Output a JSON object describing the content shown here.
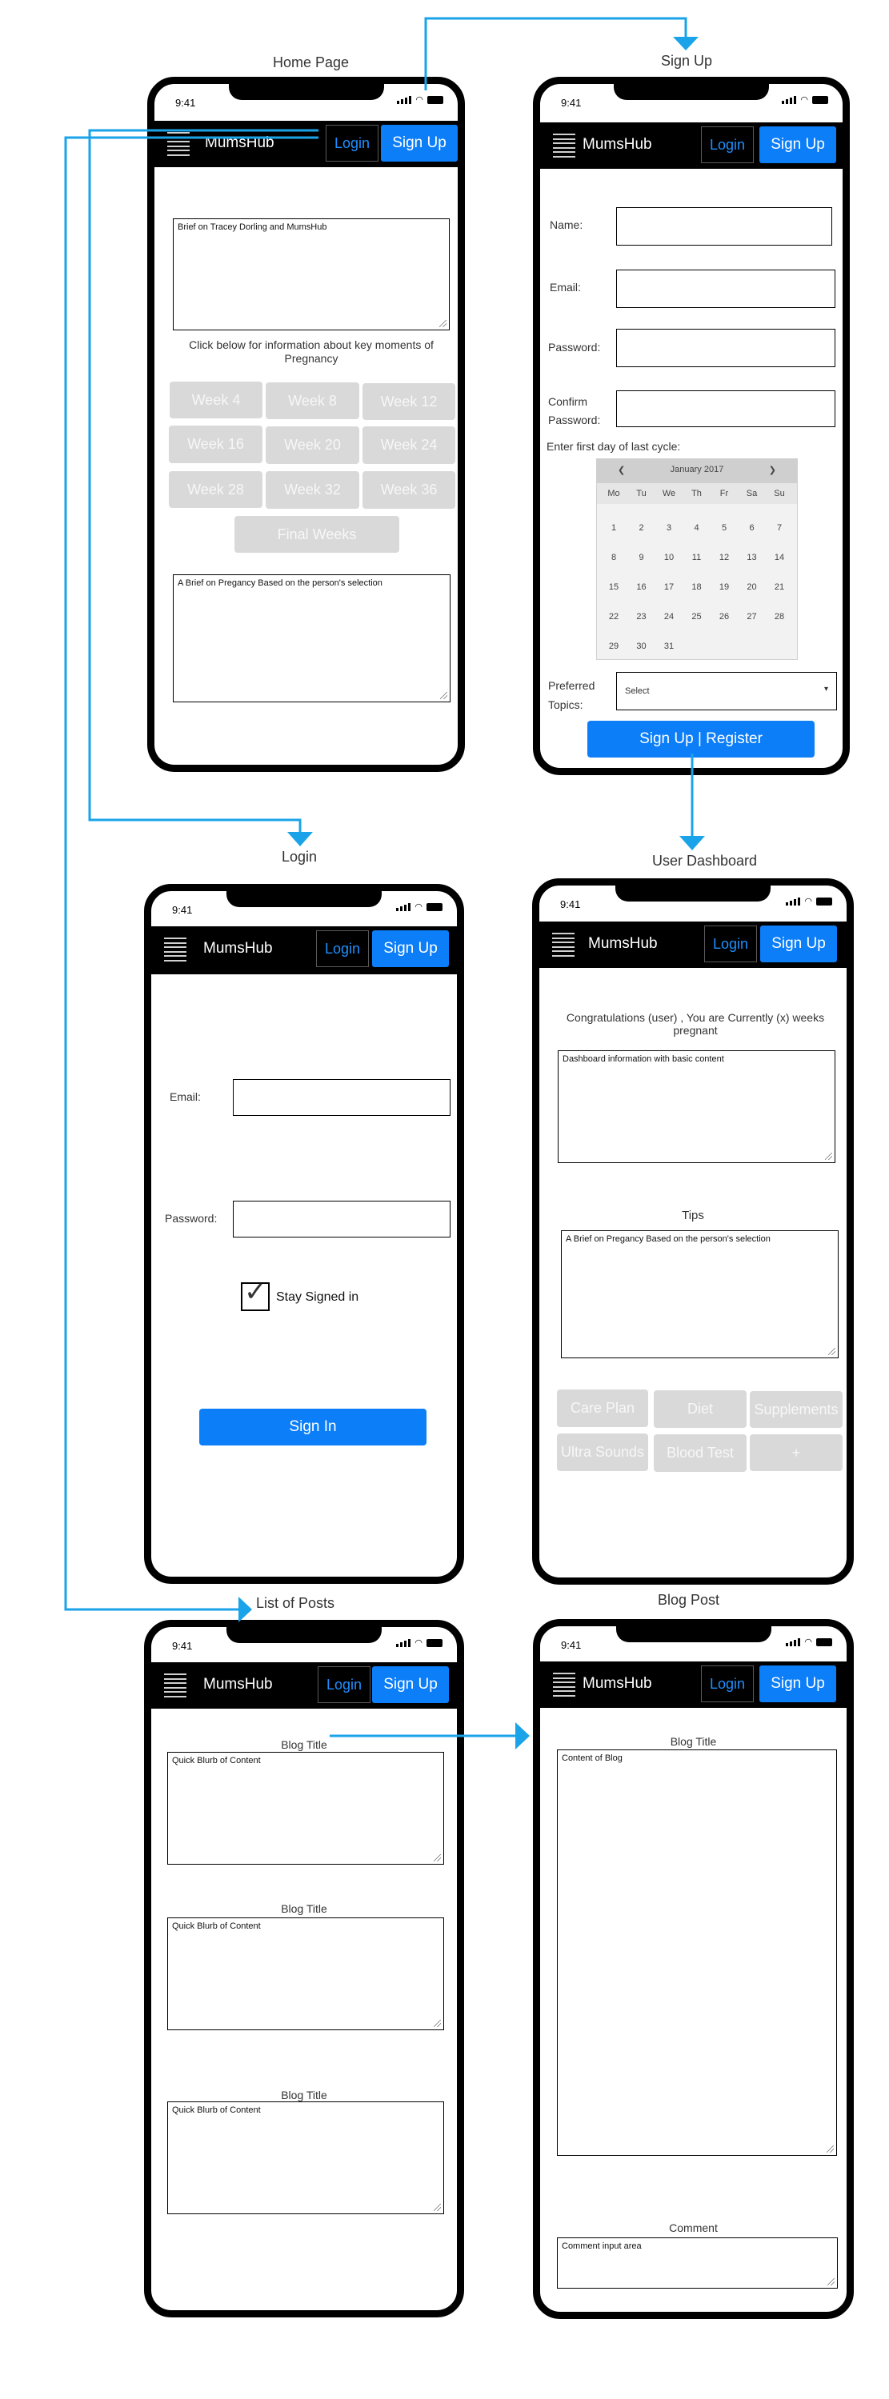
{
  "screens": {
    "home": {
      "label": "Home Page",
      "brief": "Brief on Tracey Dorling and MumsHub",
      "instructions": "Click below for information about key moments of Pregnancy",
      "weeks": [
        "Week 4",
        "Week 8",
        "Week 12",
        "Week 16",
        "Week 20",
        "Week 24",
        "Week 28",
        "Week 32",
        "Week 36"
      ],
      "final_weeks": "Final Weeks",
      "selection_brief": "A Brief on Pregancy Based on the person's selection"
    },
    "signup": {
      "label": "Sign Up",
      "name_label": "Name:",
      "email_label": "Email:",
      "password_label": "Password:",
      "confirm_label_1": "Confirm",
      "confirm_label_2": "Password:",
      "cycle_label": "Enter first day of last cycle:",
      "calendar": {
        "month": "January 2017",
        "prev": "❮",
        "next": "❯",
        "weekdays": [
          "Mo",
          "Tu",
          "We",
          "Th",
          "Fr",
          "Sa",
          "Su"
        ],
        "weeks": [
          [
            "1",
            "2",
            "3",
            "4",
            "5",
            "6",
            "7"
          ],
          [
            "8",
            "9",
            "10",
            "11",
            "12",
            "13",
            "14"
          ],
          [
            "15",
            "16",
            "17",
            "18",
            "19",
            "20",
            "21"
          ],
          [
            "22",
            "23",
            "24",
            "25",
            "26",
            "27",
            "28"
          ],
          [
            "29",
            "30",
            "31",
            "",
            "",
            "",
            ""
          ]
        ]
      },
      "topics_label_1": "Preferred",
      "topics_label_2": "Topics:",
      "topics_select": "Select",
      "register_button": "Sign Up | Register"
    },
    "login": {
      "label": "Login",
      "email_label": "Email:",
      "password_label": "Password:",
      "stay_signed_in": "Stay Signed in",
      "stay_signed_in_checked": true,
      "sign_in_button": "Sign In"
    },
    "dashboard": {
      "label": "User Dashboard",
      "congrats": "Congratulations (user) , You are Currently (x) weeks pregnant",
      "dashboard_info": "Dashboard information with basic content",
      "tips_title": "Tips",
      "tips_text": "A Brief on Pregancy Based on the person's selection",
      "buttons": [
        "Care Plan",
        "Diet",
        "Supplements",
        "Ultra Sounds",
        "Blood Test",
        "+"
      ]
    },
    "posts": {
      "label": "List of Posts",
      "items": [
        {
          "title": "Blog Title",
          "blurb": "Quick Blurb of Content"
        },
        {
          "title": "Blog Title",
          "blurb": "Quick Blurb of Content"
        },
        {
          "title": "Blog Title",
          "blurb": "Quick Blurb of Content"
        }
      ]
    },
    "blog": {
      "label": "Blog Post",
      "title": "Blog Title",
      "content": "Content of Blog",
      "comment_label": "Comment",
      "comment_placeholder": "Comment input area"
    }
  },
  "common": {
    "time": "9:41",
    "brand": "MumsHub",
    "login": "Login",
    "signup": "Sign Up"
  },
  "colors": {
    "arrow": "#1aa3e8",
    "primary_button": "#0c7ef8",
    "login_text": "#1f8fff",
    "disabled_button": "#d9d9d9"
  }
}
